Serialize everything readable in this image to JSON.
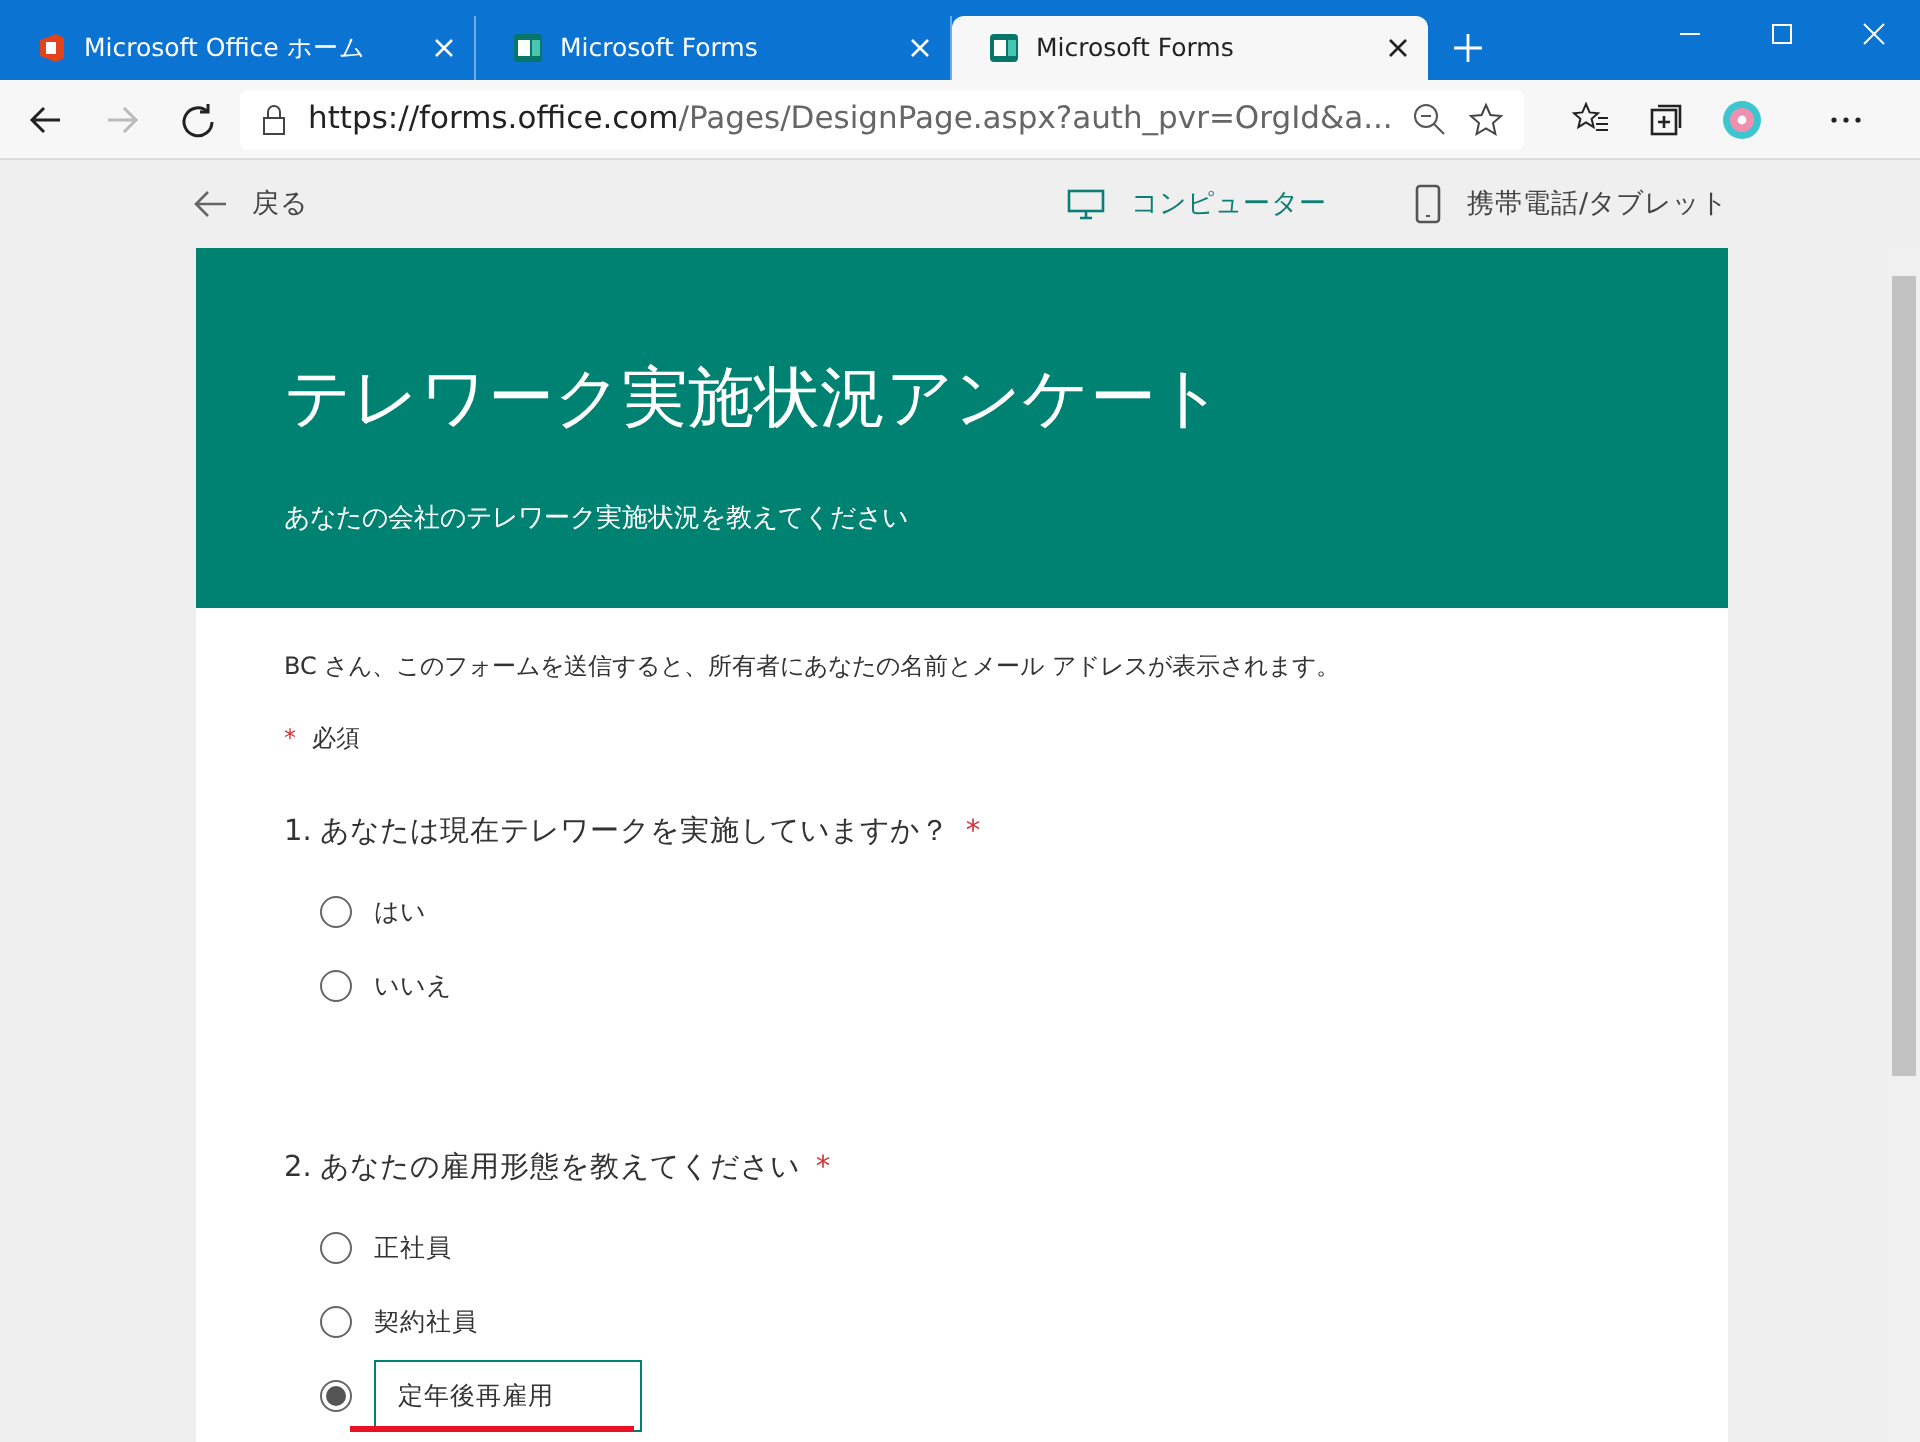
{
  "browser": {
    "tabs": [
      {
        "title": "Microsoft Office ホーム",
        "kind": "office",
        "selected": false
      },
      {
        "title": "Microsoft Forms",
        "kind": "forms",
        "selected": false
      },
      {
        "title": "Microsoft Forms",
        "kind": "forms",
        "selected": true
      }
    ],
    "url_host": "https://forms.office.com",
    "url_path": "/Pages/DesignPage.aspx?auth_pvr=OrgId&a..."
  },
  "preview_bar": {
    "back": "戻る",
    "modes": [
      {
        "label": "コンピューター",
        "kind": "computer",
        "selected": true
      },
      {
        "label": "携帯電話/タブレット",
        "kind": "phone",
        "selected": false
      }
    ]
  },
  "form": {
    "title": "テレワーク実施状況アンケート",
    "subtitle": "あなたの会社のテレワーク実施状況を教えてください",
    "notice": "BC さん、このフォームを送信すると、所有者にあなたの名前とメール アドレスが表示されます。",
    "required_mark": "*",
    "required_label": "必須",
    "questions": [
      {
        "number": "1.",
        "text": "あなたは現在テレワークを実施していますか？",
        "required_mark": "*",
        "options": [
          {
            "kind": "choice",
            "label": "はい",
            "selected": false
          },
          {
            "kind": "choice",
            "label": "いいえ",
            "selected": false
          }
        ]
      },
      {
        "number": "2.",
        "text": "あなたの雇用形態を教えてください",
        "required_mark": "*",
        "options": [
          {
            "kind": "choice",
            "label": "正社員",
            "selected": false
          },
          {
            "kind": "choice",
            "label": "契約社員",
            "selected": false
          },
          {
            "kind": "other",
            "value": "定年後再雇用",
            "selected": true,
            "underlined": true
          }
        ]
      }
    ]
  }
}
